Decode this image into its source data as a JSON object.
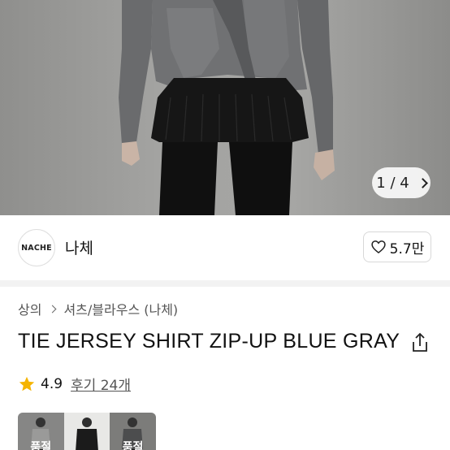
{
  "gallery": {
    "pager_current": "1",
    "pager_separator": "/",
    "pager_total": "4"
  },
  "brand": {
    "logo_text": "NACHE",
    "name": "나체",
    "like_count": "5.7만"
  },
  "breadcrumb": {
    "items": [
      "상의",
      "셔츠/블라우스 (나체)"
    ]
  },
  "product": {
    "title": "TIE JERSEY SHIRT ZIP-UP BLUE GRAY",
    "rating": "4.9",
    "reviews_label": "후기 24개"
  },
  "options": {
    "thumbnails": [
      {
        "badge": "품절"
      },
      {
        "badge": ""
      },
      {
        "badge": "품절"
      }
    ]
  },
  "colors": {
    "star": "#F5B400",
    "shirt": "#6f7072",
    "skirt": "#151515"
  }
}
